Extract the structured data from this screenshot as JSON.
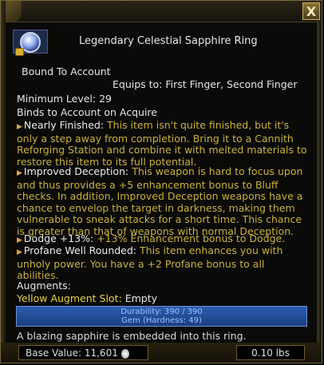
{
  "header": {
    "close_glyph": "X"
  },
  "item": {
    "name": "Legendary Celestial Sapphire Ring",
    "icon": "sapphire-ring-icon",
    "lock_icon": "lock-icon"
  },
  "binding": "Bound To Account",
  "equips_to": "Equips to: First Finger, Second Finger",
  "min_level": "Minimum Level: 29",
  "binds_acquire": "Binds to Account on Acquire",
  "effects": [
    {
      "name": "Nearly Finished:",
      "desc_line1": "This item isn't quite finished, but it's",
      "desc_lines": [
        "only a step away from completion. Bring it to a Cannith",
        "Reforging Station and combine it with melted materials to",
        "restore this item to its full potential."
      ]
    },
    {
      "name": "Improved Deception:",
      "desc_line1": "This weapon is hard to focus upon",
      "desc_lines": [
        "and thus provides a +5 enhancement bonus to Bluff",
        "checks. In addition, Improved Deception weapons have a",
        "chance to envelop the target in darkness, making them",
        "vulnerable to sneak attacks for a short time. This chance",
        "is greater than that of weapons with normal Deception."
      ]
    },
    {
      "name": "Dodge +13%:",
      "desc_line1": "+13% Enhancement bonus to Dodge.",
      "desc_lines": []
    },
    {
      "name": "Profane Well Rounded:",
      "desc_line1": "This item enhances you with",
      "desc_lines": [
        "unholy power. You have a +2 Profane bonus to all",
        "abilities."
      ]
    }
  ],
  "augments_label": "Augments:",
  "augment_slot": {
    "label": "Yellow Augment Slot:",
    "value": "Empty"
  },
  "durability_text": "Durability: 390 / 390",
  "gem_text": "Gem (Hardness: 49)",
  "description": "A blazing sapphire is embedded into this ring.",
  "footer": {
    "base_value": "Base Value: 11,601",
    "coin_icon": "platinum-coin-icon",
    "weight": "0.10 lbs"
  },
  "colors": {
    "effect_name": "#ececec",
    "effect_desc": "#c9b23e",
    "durability_bar": "#2b5db0"
  }
}
